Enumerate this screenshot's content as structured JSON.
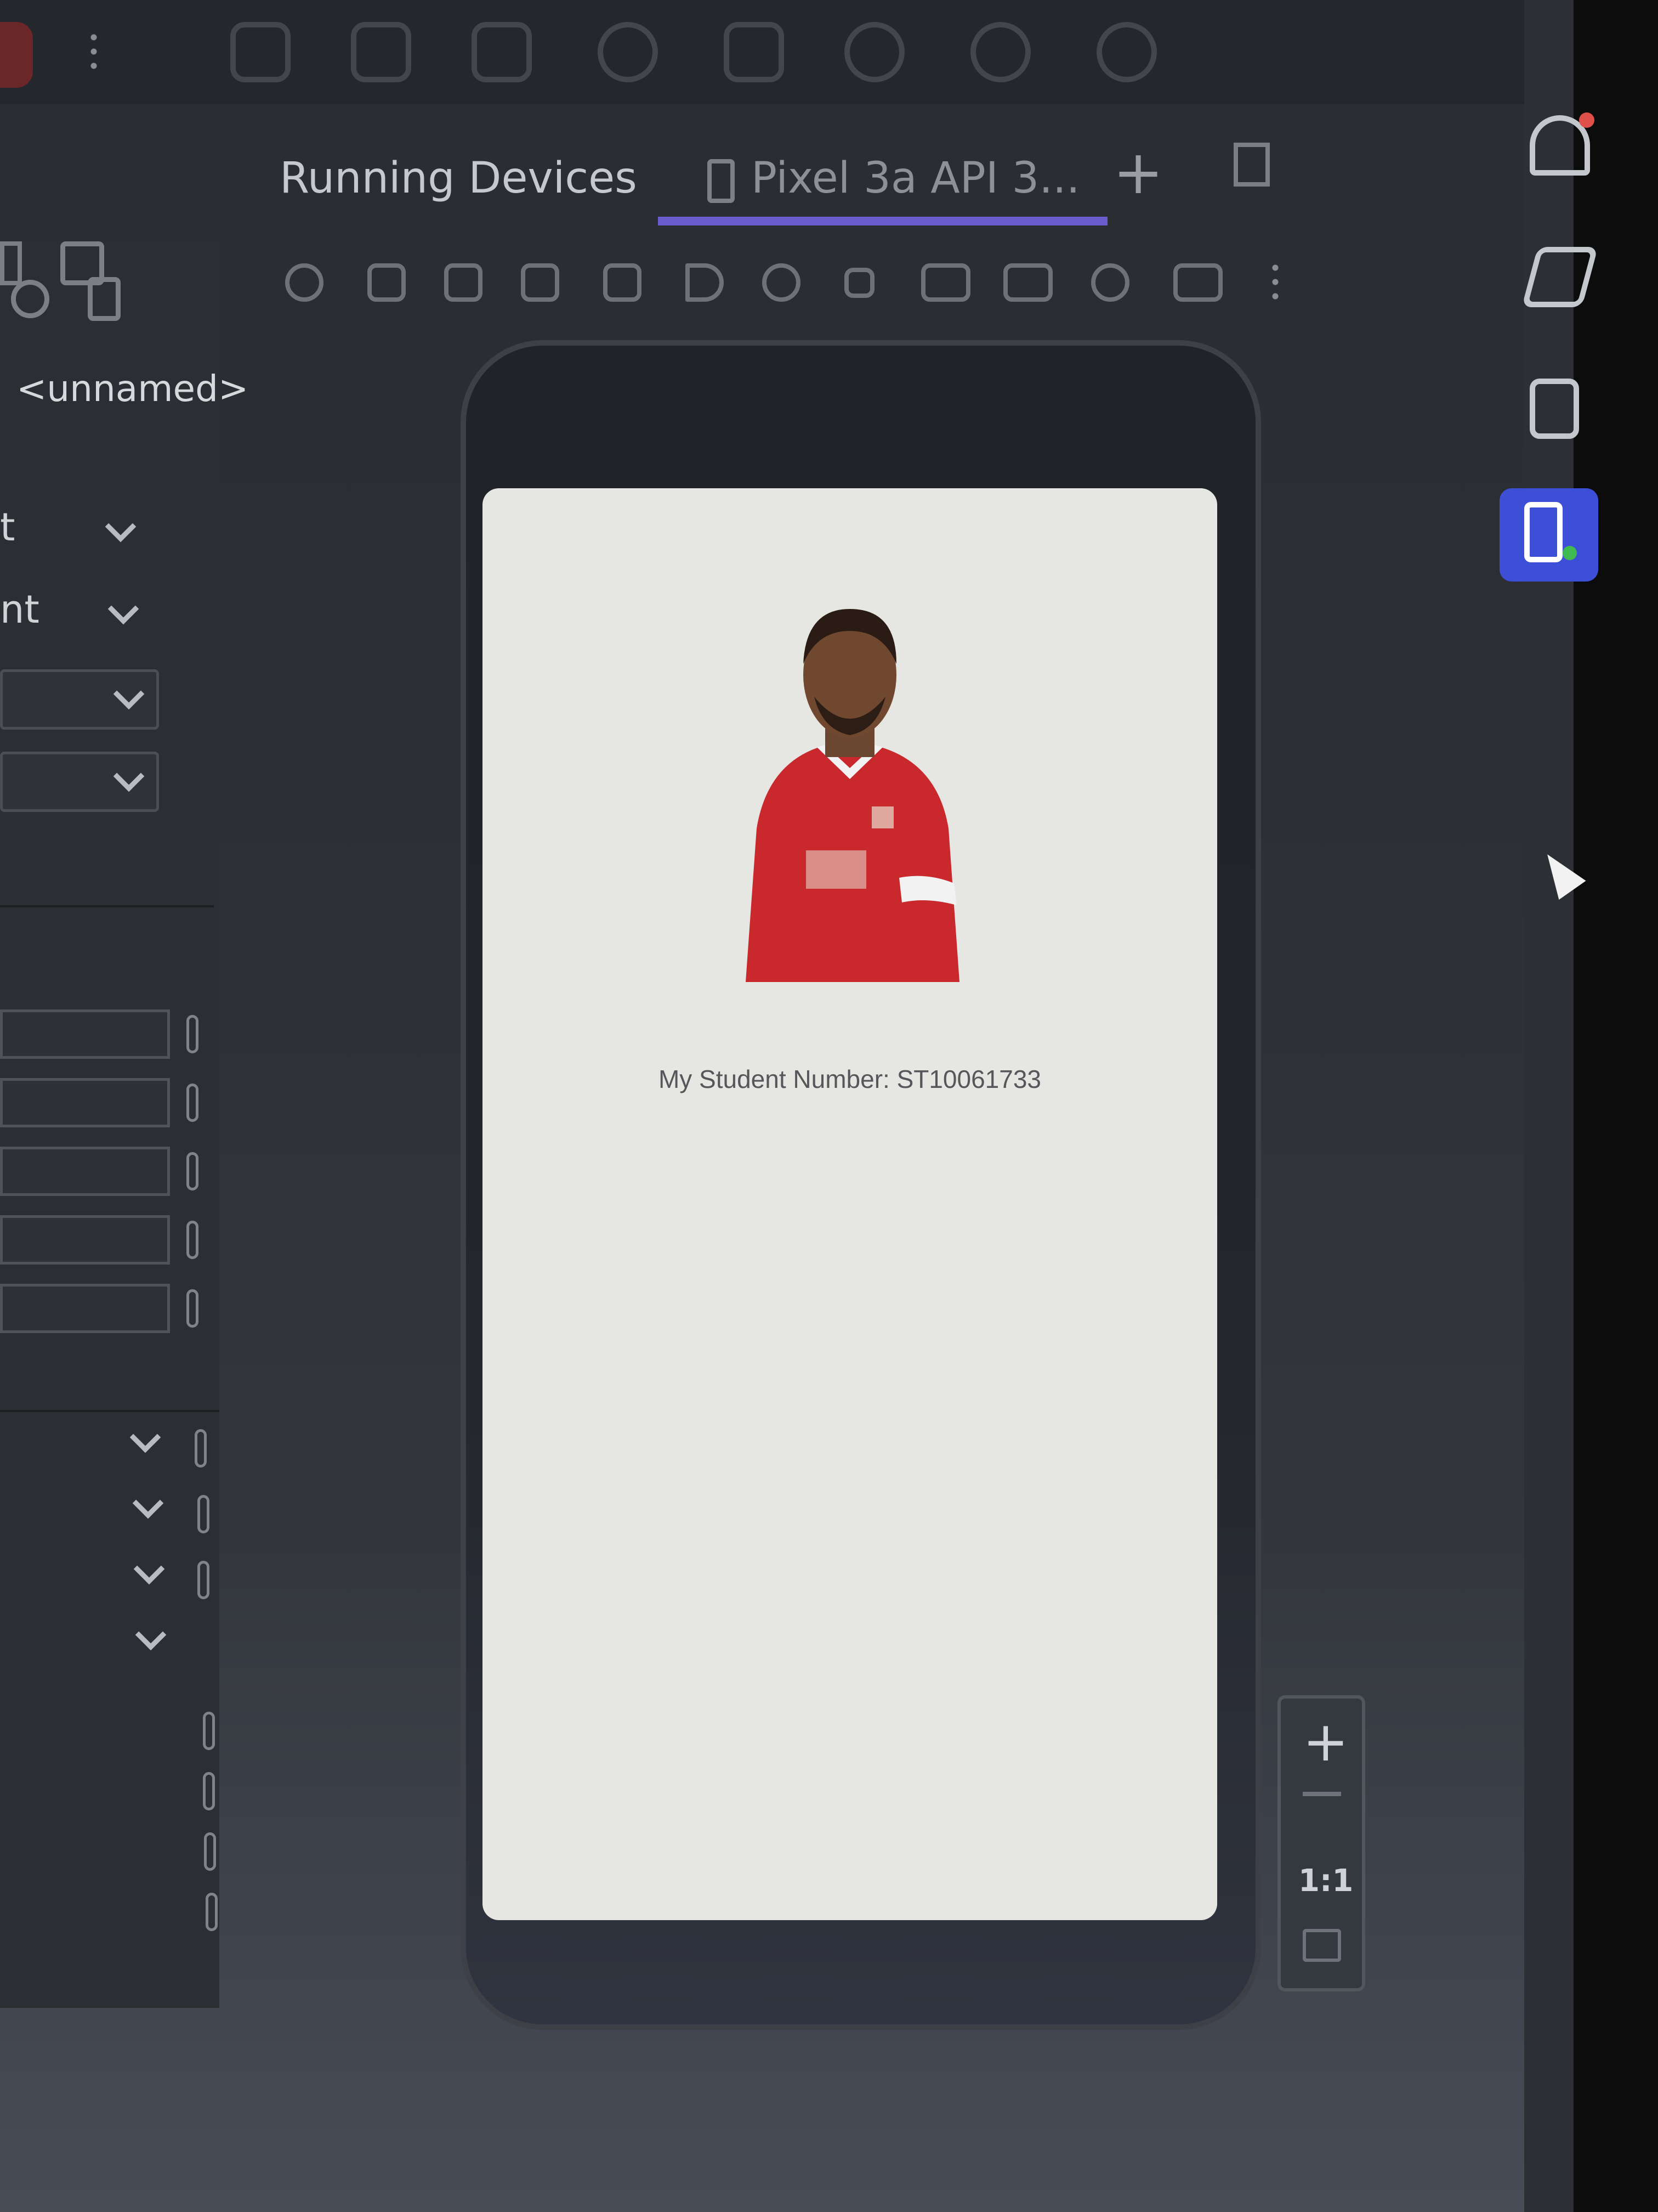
{
  "tabs": {
    "running_devices": "Running Devices",
    "active_device": "Pixel 3a API 3...",
    "add": "+"
  },
  "properties": {
    "component_name": "<unnamed>",
    "row1_value": "t",
    "row2_value": "nt"
  },
  "emulator": {
    "student_number_text": "My Student Number: ST10061733"
  },
  "zoom": {
    "plus": "+",
    "one_to_one": "1:1"
  },
  "icons": {
    "top_toolbar": [
      "run-icon",
      "more-icon",
      "device-manager-icon",
      "build-icon",
      "sync-icon",
      "debug-icon",
      "profiler-icon",
      "search-icon",
      "settings-icon",
      "account-icon"
    ],
    "device_toolbar": [
      "power-icon",
      "volume-up-icon",
      "volume-down-icon",
      "rotate-left-icon",
      "rotate-right-icon",
      "back-icon",
      "home-icon",
      "overview-icon",
      "screenshot-icon",
      "record-icon",
      "snapshot-icon",
      "extended-controls-icon",
      "more-icon"
    ],
    "right_strip": [
      "notifications-icon",
      "gemini-icon",
      "device-manager-icon",
      "running-devices-icon"
    ]
  },
  "colors": {
    "accent": "#3d4fd6",
    "tab_underline": "#6a5ccf",
    "jersey_red": "#c9282d"
  }
}
